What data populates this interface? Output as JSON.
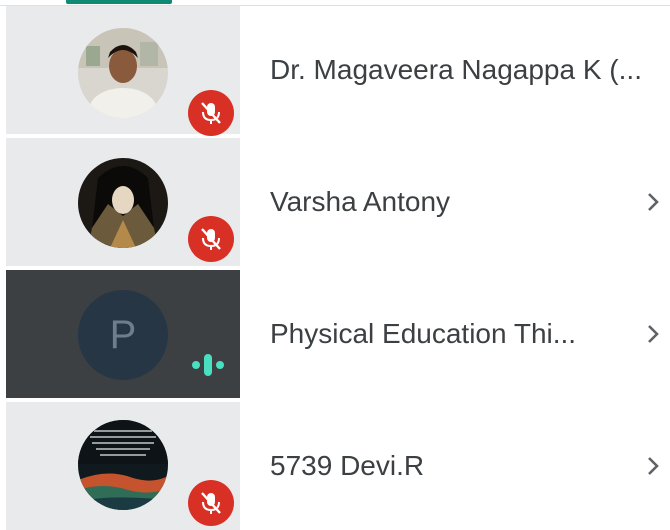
{
  "participants": [
    {
      "name": "Dr. Magaveera Nagappa K (...",
      "muted": true,
      "avatar_icon": "photo-avatar-man",
      "has_chevron": false
    },
    {
      "name": "Varsha Antony",
      "muted": true,
      "avatar_icon": "photo-avatar-illustration",
      "has_chevron": true
    },
    {
      "name": "Physical Education Thi...",
      "muted": false,
      "avatar_letter": "P",
      "speaking": true,
      "has_chevron": true
    },
    {
      "name": "5739 Devi.R",
      "muted": true,
      "avatar_icon": "photo-avatar-landscape",
      "has_chevron": true
    }
  ],
  "colors": {
    "mute_badge": "#d93025",
    "speaking_indicator": "#49e0c2",
    "active_row": "#3c4043",
    "avatar_column": "#e9eaec",
    "tab_indicator": "#0f8a74"
  }
}
